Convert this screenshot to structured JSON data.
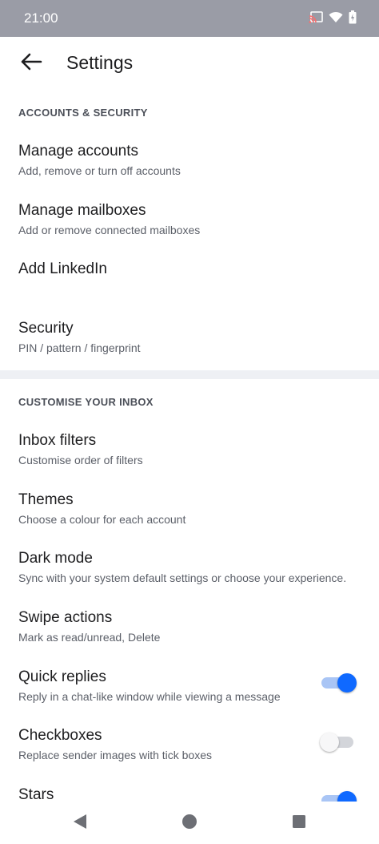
{
  "status_bar": {
    "time": "21:00",
    "icons": [
      "cast-icon",
      "wifi-icon",
      "battery-icon"
    ]
  },
  "app_bar": {
    "title": "Settings",
    "back_icon": "arrow-back-icon"
  },
  "sections": [
    {
      "header": "ACCOUNTS & SECURITY",
      "items": [
        {
          "title": "Manage accounts",
          "subtitle": "Add, remove or turn off accounts"
        },
        {
          "title": "Manage mailboxes",
          "subtitle": "Add or remove connected mailboxes"
        },
        {
          "title": "Add LinkedIn",
          "subtitle": ""
        },
        {
          "title": "Security",
          "subtitle": "PIN / pattern / fingerprint"
        }
      ]
    },
    {
      "header": "CUSTOMISE YOUR INBOX",
      "items": [
        {
          "title": "Inbox filters",
          "subtitle": "Customise order of filters"
        },
        {
          "title": "Themes",
          "subtitle": "Choose a colour for each account"
        },
        {
          "title": "Dark mode",
          "subtitle": "Sync with your system default settings or choose your experience."
        },
        {
          "title": "Swipe actions",
          "subtitle": "Mark as read/unread, Delete"
        },
        {
          "title": "Quick replies",
          "subtitle": "Reply in a chat-like window while viewing a message",
          "toggle": true
        },
        {
          "title": "Checkboxes",
          "subtitle": "Replace sender images with tick boxes",
          "toggle": false
        },
        {
          "title": "Stars",
          "subtitle": "",
          "toggle": true
        }
      ]
    }
  ],
  "colors": {
    "status_bar": "#9a9ca6",
    "accent": "#0f69ff",
    "divider": "#eef0f4"
  },
  "nav_bar": [
    "back-triangle-icon",
    "home-circle-icon",
    "recents-square-icon"
  ]
}
